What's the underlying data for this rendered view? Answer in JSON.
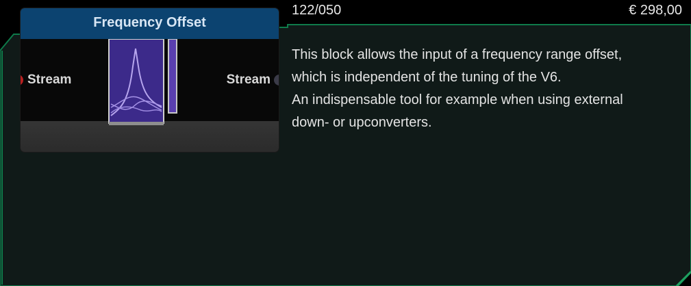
{
  "header": {
    "code": "122/050",
    "price": "€ 298,00"
  },
  "node": {
    "title": "Frequency Offset",
    "input_port": {
      "label": "Stream",
      "color": "#b82020"
    },
    "output_port": {
      "label": "Stream",
      "color": "#3b3b48"
    }
  },
  "description": {
    "line1": "This block allows the input of a frequency range offset,",
    "line2": "which is independent of the tuning of the V6.",
    "line3": "An indispensable tool for example when using external",
    "line4": "down- or upconverters."
  },
  "colors": {
    "frame": "#0e7a4a",
    "panel_bg": "#101a18",
    "title_bar": "#0c4370",
    "preview_purple": "#3c2a8a"
  }
}
